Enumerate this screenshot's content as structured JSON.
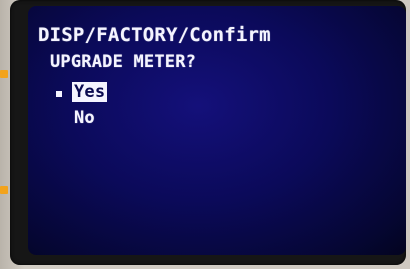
{
  "screen": {
    "breadcrumb": "DISP/FACTORY/Confirm",
    "question": "UPGRADE METER?",
    "options": [
      {
        "label": "Yes",
        "selected": true
      },
      {
        "label": "No",
        "selected": false
      }
    ]
  },
  "colors": {
    "screen_background": "#0b0a5a",
    "text": "#f4f4ff",
    "side_key_marker": "#f2a31c"
  }
}
